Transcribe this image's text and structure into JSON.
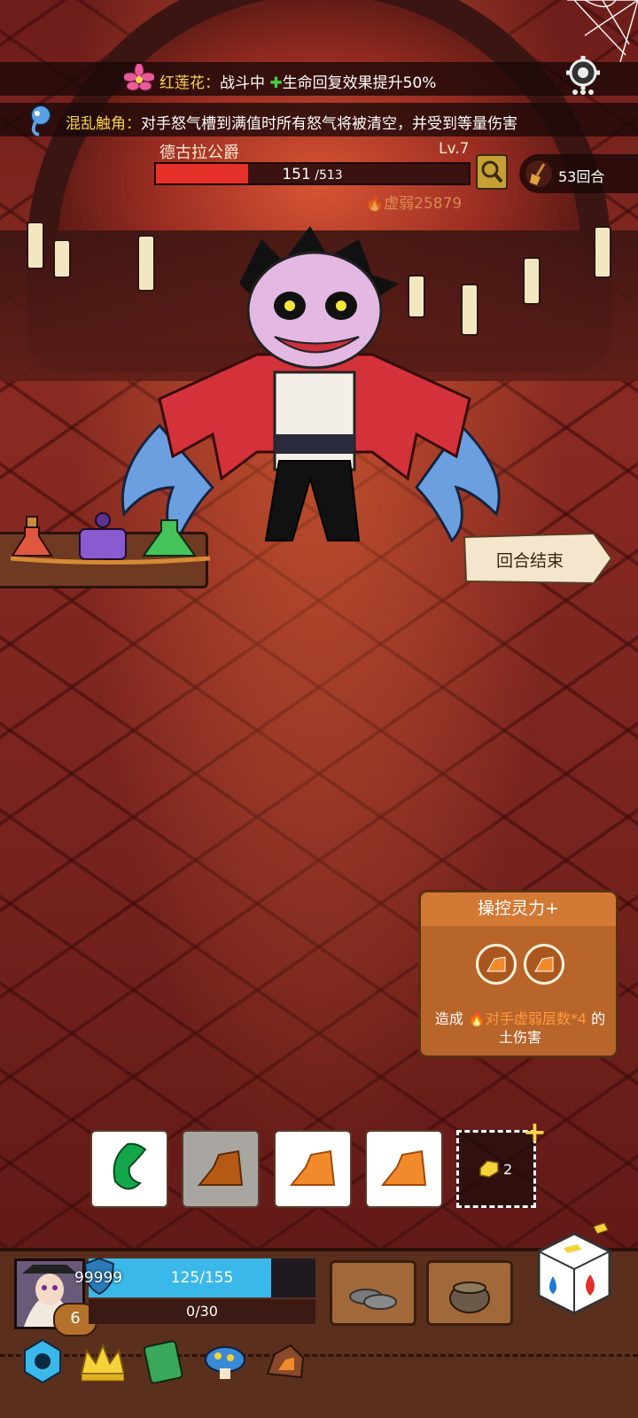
{
  "buff_bar": {
    "name": "红莲花",
    "separator": "：",
    "status": "战斗中",
    "effect": "生命回复效果提升50%"
  },
  "debuff_bar": {
    "name": "混乱触角",
    "separator": "：",
    "effect": "对手怒气槽到满值时所有怒气将被清空，并受到等量伤害"
  },
  "boss": {
    "name": "德古拉公爵",
    "level": "Lv.7",
    "hp_current": "151",
    "hp_max": " /513",
    "hp_fraction": 0.294,
    "weak_label": "虚弱25879"
  },
  "turn_counter": "53回合",
  "end_turn_label": "回合结束",
  "skill_card": {
    "title": "操控灵力+",
    "desc_prefix": "造成 ",
    "desc_highlight": "对手虚弱层数*4",
    "desc_suffix": " 的",
    "desc_line2": "土伤害"
  },
  "hand": {
    "extra_slot_count": "2",
    "add_symbol": "+"
  },
  "player": {
    "shield": "99999",
    "hp": "125/155",
    "hp_fraction": 0.806,
    "energy": "0/30",
    "energy_fraction": 0.0,
    "level": "6"
  },
  "colors": {
    "hp_bar": "#e6302a",
    "player_hp": "#3ab8ea",
    "accent_gold": "#f6d34a",
    "highlight_orange": "#ff9a3a"
  },
  "icons": [
    "settings-gear-icon",
    "lotus-icon",
    "tentacle-icon",
    "magnifier-icon",
    "broom-icon",
    "shield-icon",
    "crown-icon",
    "dice-icon"
  ]
}
